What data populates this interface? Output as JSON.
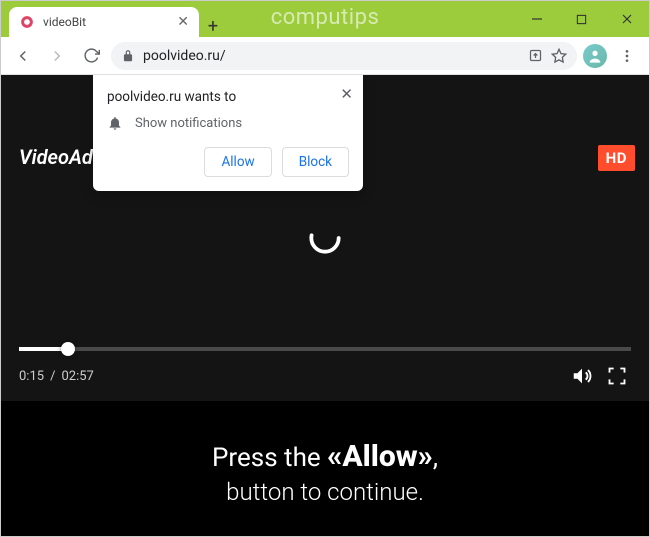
{
  "colors": {
    "titlebar": "#9ccc3c",
    "hd_badge": "#ff4d2e",
    "link_blue": "#1a73e8"
  },
  "window": {
    "watermark": "computips"
  },
  "tab": {
    "title": "videoBit"
  },
  "addressbar": {
    "url": "poolvideo.ru/"
  },
  "notification": {
    "origin": "poolvideo.ru wants to",
    "prompt": "Show notifications",
    "allow": "Allow",
    "block": "Block"
  },
  "page": {
    "brand": "VideoAd",
    "hd": "HD",
    "time_current": "0:15",
    "time_sep": " / ",
    "time_total": "02:57",
    "msg_prefix": "Press the ",
    "msg_strong": "«Allow»",
    "msg_suffix": ",",
    "msg_line2": "button to continue."
  }
}
